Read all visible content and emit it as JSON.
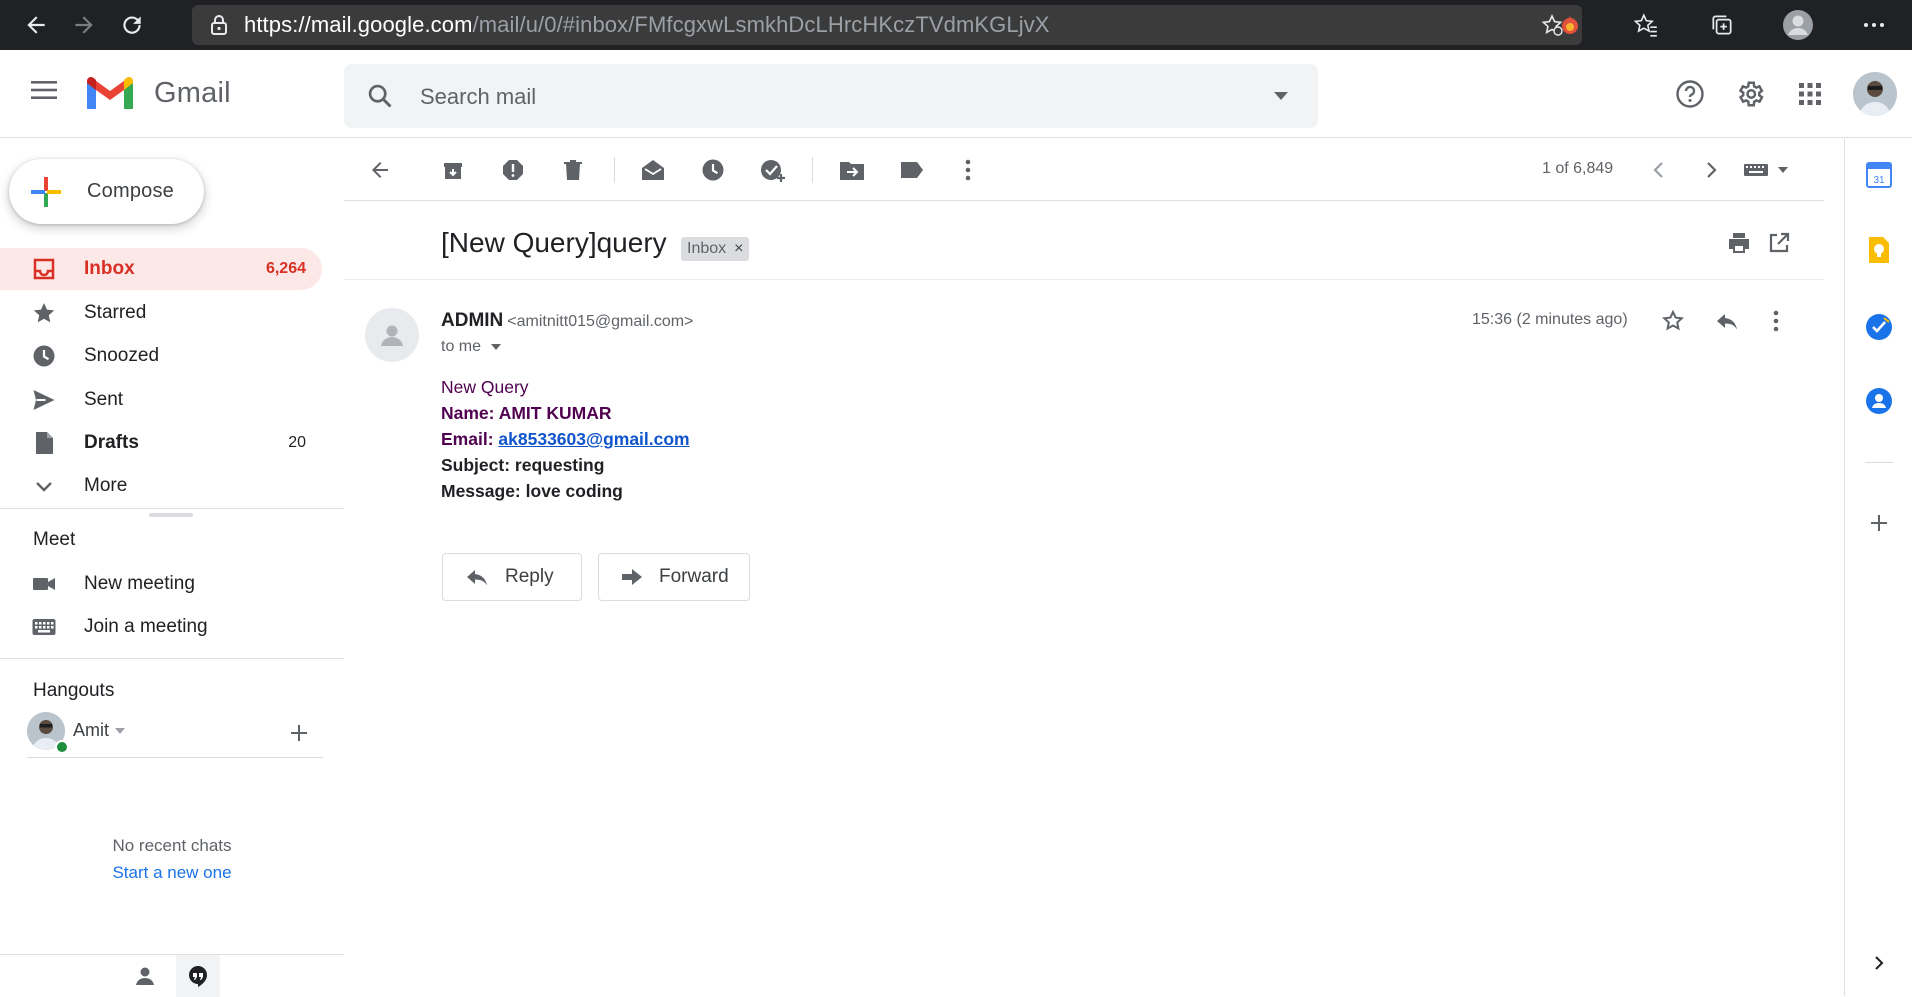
{
  "browser": {
    "url_host": "https://mail.google.com",
    "url_path": "/mail/u/0/#inbox/FMfcgxwLsmkhDcLHrcHKczTVdmKGLjvX"
  },
  "header": {
    "app_name": "Gmail",
    "search_placeholder": "Search mail"
  },
  "sidebar": {
    "compose_label": "Compose",
    "items": [
      {
        "label": "Inbox",
        "count": "6,264",
        "icon": "inbox-icon"
      },
      {
        "label": "Starred",
        "count": "",
        "icon": "star-icon"
      },
      {
        "label": "Snoozed",
        "count": "",
        "icon": "clock-icon"
      },
      {
        "label": "Sent",
        "count": "",
        "icon": "send-icon"
      },
      {
        "label": "Drafts",
        "count": "20",
        "icon": "draft-icon"
      },
      {
        "label": "More",
        "count": "",
        "icon": "chevron-down-icon"
      }
    ],
    "meet": {
      "title": "Meet",
      "new_meeting": "New meeting",
      "join_meeting": "Join a meeting"
    },
    "hangouts": {
      "title": "Hangouts",
      "user": "Amit",
      "no_chats": "No recent chats",
      "start_new": "Start a new one"
    }
  },
  "toolbar": {
    "pager": "1 of 6,849"
  },
  "email": {
    "subject": "[New Query]query",
    "label": "Inbox",
    "sender_name": "ADMIN",
    "sender_email": "<amitnitt015@gmail.com>",
    "to": "to me",
    "time": "15:36 (2 minutes ago)",
    "body": {
      "heading": "New Query",
      "name_label": "Name:",
      "name_value": "AMIT KUMAR",
      "email_label": "Email:",
      "email_value": "ak8533603@gmail.com",
      "subject_label": "Subject:",
      "subject_value": "requesting",
      "message_label": "Message:",
      "message_value": "love coding"
    },
    "reply_label": "Reply",
    "forward_label": "Forward"
  },
  "colors": {
    "accent_red": "#d93025",
    "active_bg": "#fce8e6",
    "link_blue": "#1155cc",
    "body_purple": "#500050"
  }
}
